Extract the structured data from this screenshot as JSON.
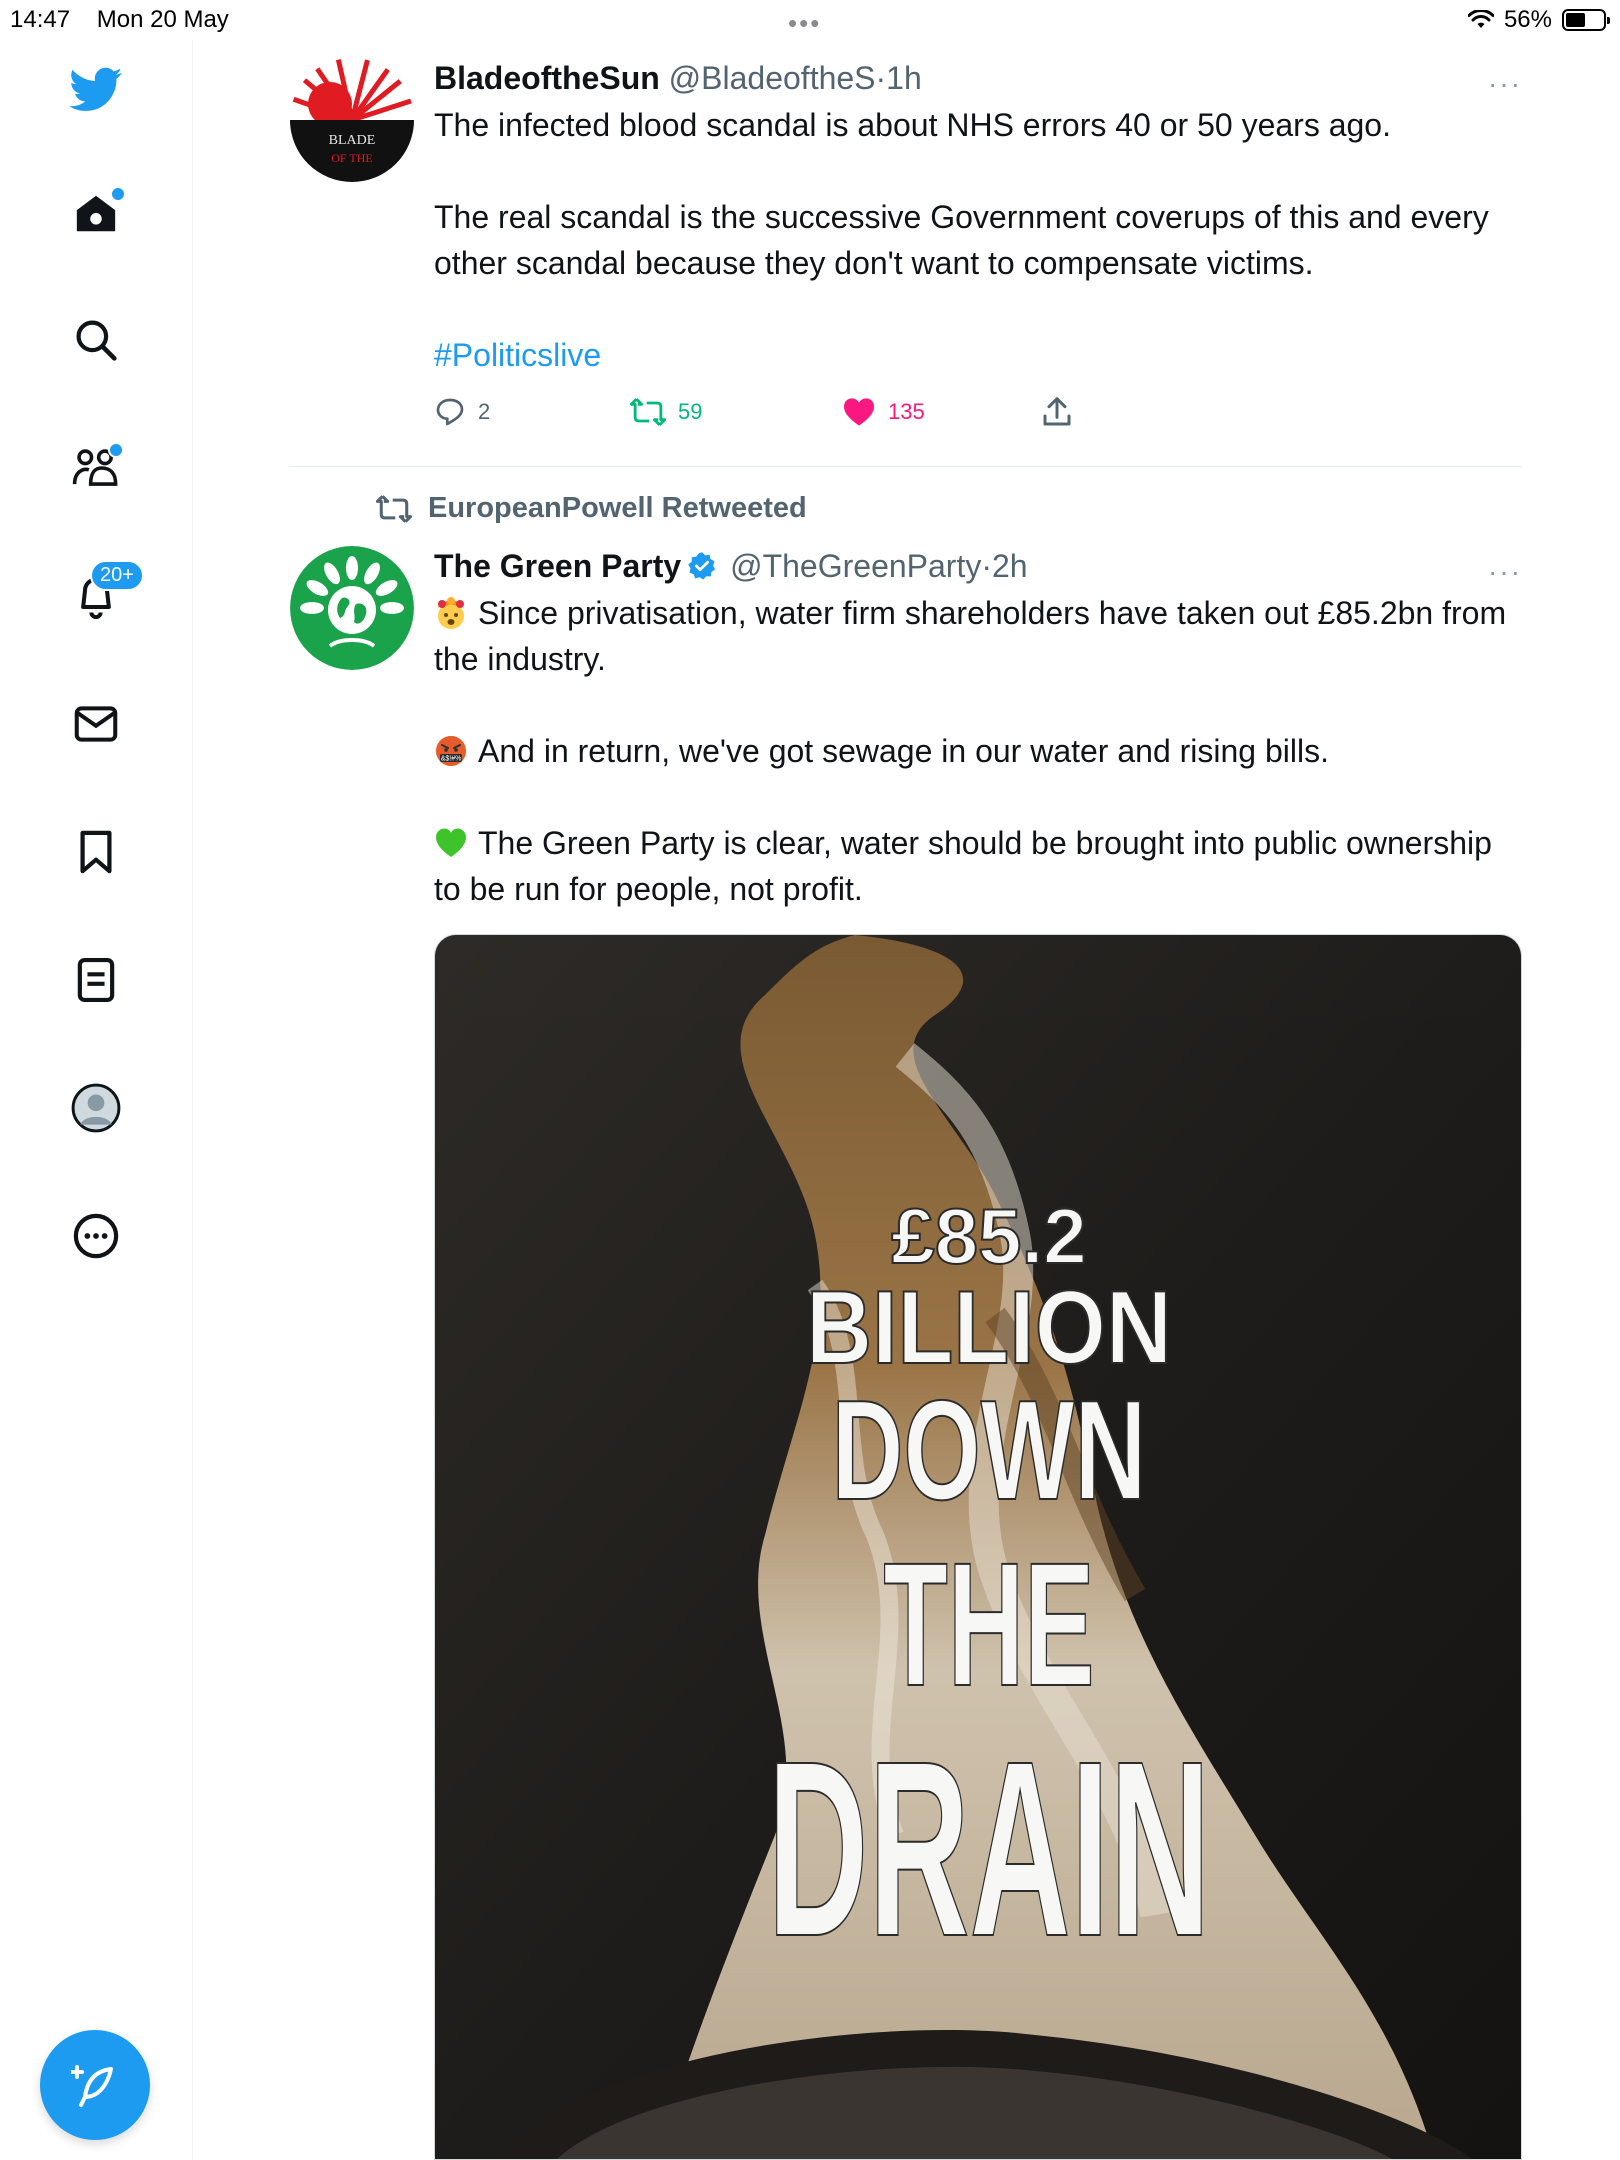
{
  "status_bar": {
    "time": "14:47",
    "date": "Mon 20 May",
    "battery_percent": "56%",
    "battery_level": 0.56
  },
  "sidebar": {
    "items": [
      {
        "icon": "twitter-bird-icon",
        "label": "Twitter"
      },
      {
        "icon": "home-icon",
        "label": "Home",
        "has_dot": true
      },
      {
        "icon": "search-icon",
        "label": "Explore"
      },
      {
        "icon": "communities-icon",
        "label": "Communities",
        "has_dot": true
      },
      {
        "icon": "bell-icon",
        "label": "Notifications",
        "badge": "20+"
      },
      {
        "icon": "mail-icon",
        "label": "Messages"
      },
      {
        "icon": "bookmark-icon",
        "label": "Bookmarks"
      },
      {
        "icon": "list-icon",
        "label": "Lists"
      },
      {
        "icon": "profile-icon",
        "label": "Profile"
      },
      {
        "icon": "more-circle-icon",
        "label": "More"
      }
    ],
    "notification_badge": "20+",
    "compose_icon": "compose-feather-icon",
    "accent": "#1d9bf0"
  },
  "tweets": [
    {
      "name": "BladeoftheSun",
      "handle": "@BladeoftheS",
      "sep": "·",
      "time": "1h",
      "more": "···",
      "paragraphs": [
        "The infected blood scandal is about NHS errors 40 or 50 years ago.",
        "The real scandal is the successive Government coverups of this and every other scandal because they don't want to compensate victims."
      ],
      "hashtag": "#Politicslive",
      "avatar_text": [
        "BLADE",
        "OF THE"
      ],
      "replies": "2",
      "retweets": "59",
      "likes": "135",
      "liked": true
    },
    {
      "retweeted_by": "EuropeanPowell Retweeted",
      "name": "The Green Party",
      "verified": true,
      "handle": "@TheGreenParty",
      "sep": "·",
      "time": "2h",
      "more": "···",
      "paragraphs": [
        "Since privatisation, water firm shareholders have taken out £85.2bn from the industry.",
        "And in return, we've got sewage in our water and rising bills.",
        "The Green Party is clear, water should be brought into public ownership to be run for people, not profit."
      ],
      "emojis": [
        "exploding-head-emoji",
        "swearing-face-emoji",
        "green-heart-emoji"
      ],
      "media_text": [
        "£85.2",
        "BILLION",
        "DOWN",
        "THE",
        "DRAIN"
      ]
    }
  ],
  "colors": {
    "like": "#f91880",
    "retweet": "#00ba7c",
    "link": "#1d9bf0",
    "green_party": "#1ba34b"
  }
}
